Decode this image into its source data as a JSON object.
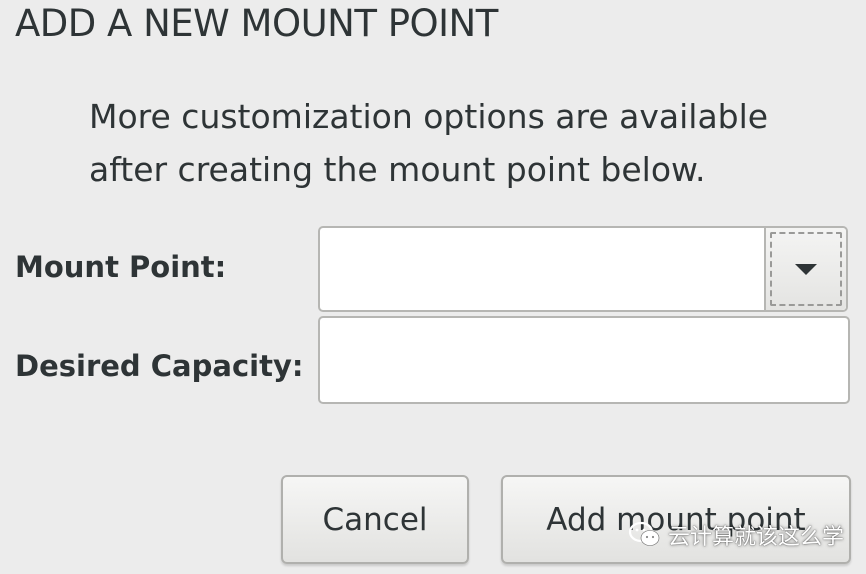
{
  "dialog": {
    "title": "ADD A NEW MOUNT POINT",
    "info_line1": "More customization options are available",
    "info_line2": "after creating the mount point below."
  },
  "form": {
    "mount_point_label": "Mount Point:",
    "mount_point_value": "",
    "desired_capacity_label": "Desired Capacity:",
    "desired_capacity_value": ""
  },
  "buttons": {
    "cancel_label": "Cancel",
    "add_label": "Add mount point"
  },
  "watermark": {
    "text": "云计算就该这么学",
    "icon": "wechat-icon"
  },
  "colors": {
    "background": "#ececec",
    "text": "#2e3436"
  }
}
